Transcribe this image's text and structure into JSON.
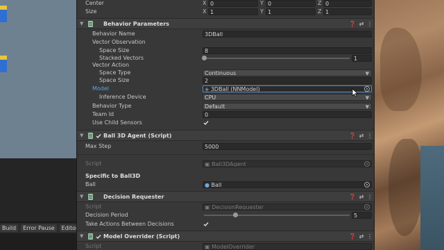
{
  "transform": {
    "center": {
      "label": "Center",
      "x_axis": "X",
      "x": "0",
      "y_axis": "Y",
      "y": "0",
      "z_axis": "Z",
      "z": "0"
    },
    "size": {
      "label": "Size",
      "x_axis": "X",
      "x": "1",
      "y_axis": "Y",
      "y": "1",
      "z_axis": "Z",
      "z": "1"
    }
  },
  "behavior_parameters": {
    "title": "Behavior Parameters",
    "behavior_name_label": "Behavior Name",
    "behavior_name": "3DBall",
    "vector_observation_label": "Vector Observation",
    "obs_space_size_label": "Space Size",
    "obs_space_size": "8",
    "stacked_vectors_label": "Stacked Vectors",
    "stacked_vectors": "1",
    "vector_action_label": "Vector Action",
    "space_type_label": "Space Type",
    "space_type": "Continuous",
    "act_space_size_label": "Space Size",
    "act_space_size": "2",
    "model_label": "Model",
    "model": "3DBall (NNModel)",
    "inference_device_label": "Inference Device",
    "inference_device": "CPU",
    "behavior_type_label": "Behavior Type",
    "behavior_type": "Default",
    "team_id_label": "Team Id",
    "team_id": "0",
    "use_child_sensors_label": "Use Child Sensors",
    "use_child_sensors": true
  },
  "ball_agent": {
    "title": "Ball 3D Agent (Script)",
    "max_step_label": "Max Step",
    "max_step": "5000",
    "script_label": "Script",
    "script": "Ball3DAgent",
    "section_label": "Specific to Ball3D",
    "ball_label": "Ball",
    "ball": "Ball"
  },
  "decision_requester": {
    "title": "Decision Requester",
    "script_label": "Script",
    "script": "DecisionRequester",
    "decision_period_label": "Decision Period",
    "decision_period": "5",
    "take_actions_label": "Take Actions Between Decisions",
    "take_actions": true
  },
  "model_overrider": {
    "title": "Model Overrider (Script)",
    "script_label": "Script",
    "script": "ModelOverrider"
  },
  "scene_bar": {
    "build": "Build",
    "error_pause": "Error Pause",
    "editor": "Editor ▾"
  },
  "icons": [
    "help-icon",
    "presets-icon",
    "more-icon",
    "component-icon",
    "fold-arrow-icon",
    "object-picker-icon",
    "dropdown-arrow-icon",
    "checkbox-icon",
    "mouse-cursor-icon"
  ],
  "colors": {
    "inspector_bg": "#383838",
    "field_bg": "#2a2a2a",
    "header_bg": "#3e3e3e",
    "link_blue": "#5fa0e6"
  }
}
